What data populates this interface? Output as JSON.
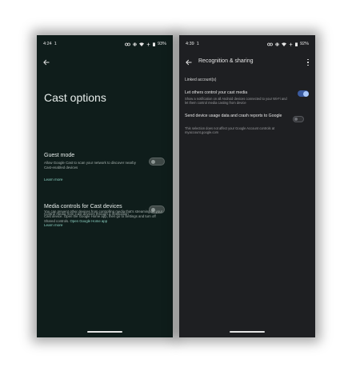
{
  "left_phone": {
    "status": {
      "time": "4:24",
      "extra": "1",
      "battery": "93%"
    },
    "title": "Cast options",
    "guest_mode": {
      "title": "Guest mode",
      "description": "Allow Google Cast to scan your network to discover nearby Cast-enabled devices",
      "learn_more": "Learn more",
      "enabled": false
    },
    "media_controls": {
      "title": "Media controls for Cast devices",
      "description": "Control media from Cast devices through a notification",
      "learn_more": "Learn more",
      "enabled": false
    },
    "footer": {
      "text": "You can prevent other devices from controlling media that's streaming on your Cast device. Open the Google Home app, then go to Settings and turn off Shared controls.",
      "link": "Open Google Home app"
    }
  },
  "right_phone": {
    "status": {
      "time": "4:39",
      "extra": "1",
      "battery": "92%"
    },
    "title": "Recognition & sharing",
    "section_label": "Linked account(s)",
    "cast_control": {
      "title": "Let others control your cast media",
      "description": "Show a notification on all Android devices connected to your Wi-Fi and let them control media casting from device",
      "enabled": true
    },
    "usage_data": {
      "title": "Send device usage data and crash reports to Google",
      "description": "This selection does not affect your Google Account controls at myaccount.google.com",
      "enabled": false
    }
  },
  "colors": {
    "left_bg": "#0f1d1b",
    "right_bg": "#1e1f22",
    "accent_teal": "#8dd3c4",
    "toggle_on": "#a8c7fa"
  }
}
